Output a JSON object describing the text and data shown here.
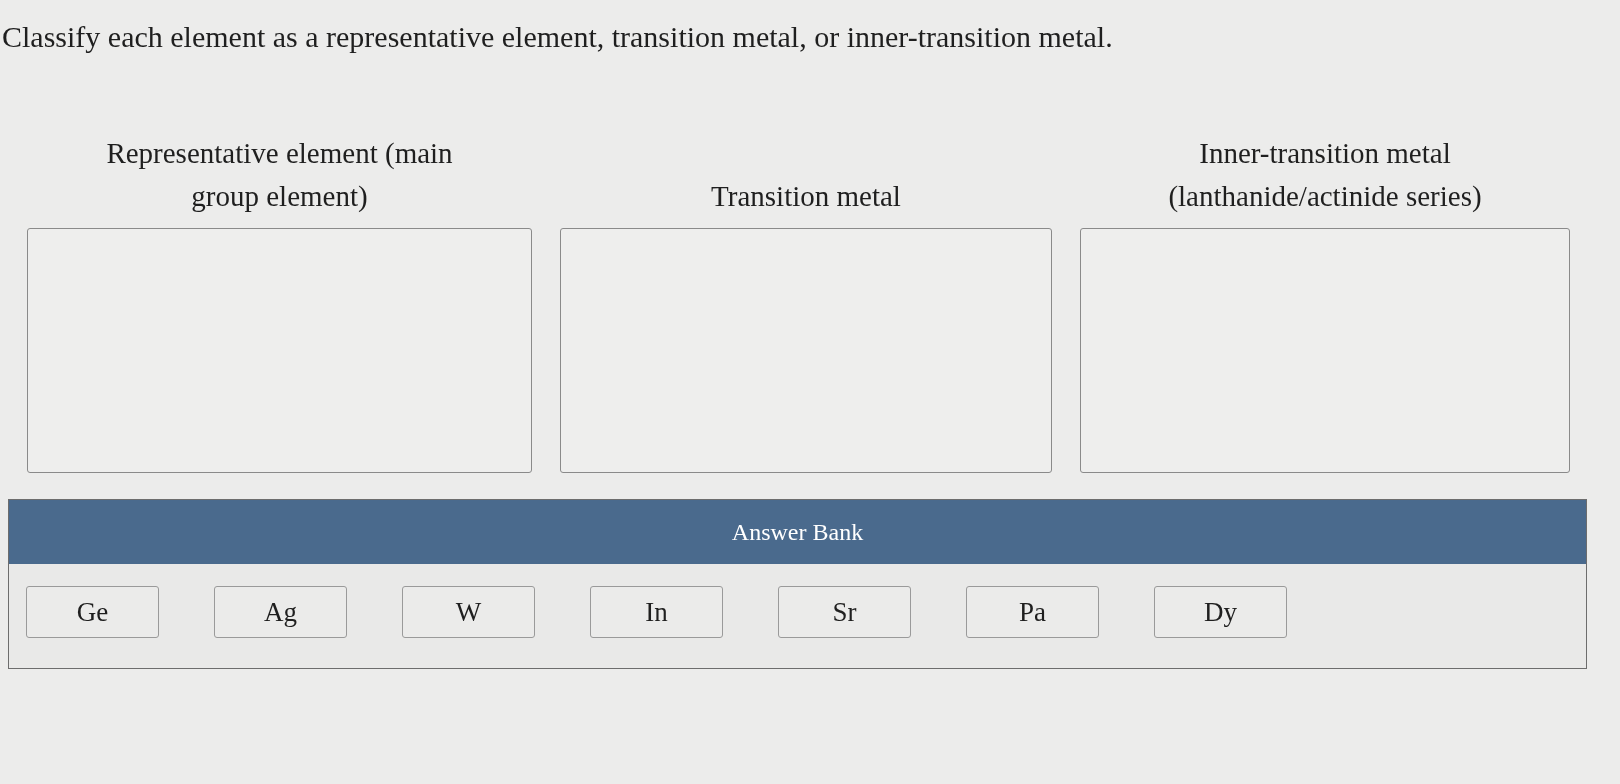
{
  "prompt": "Classify each element as a representative element, transition metal, or inner-transition metal.",
  "categories": [
    {
      "heading": "Representative element (main group element)"
    },
    {
      "heading": "Transition metal"
    },
    {
      "heading": "Inner-transition metal (lanthanide/actinide series)"
    }
  ],
  "answer_bank": {
    "title": "Answer Bank",
    "tiles": [
      "Ge",
      "Ag",
      "W",
      "In",
      "Sr",
      "Pa",
      "Dy"
    ]
  }
}
